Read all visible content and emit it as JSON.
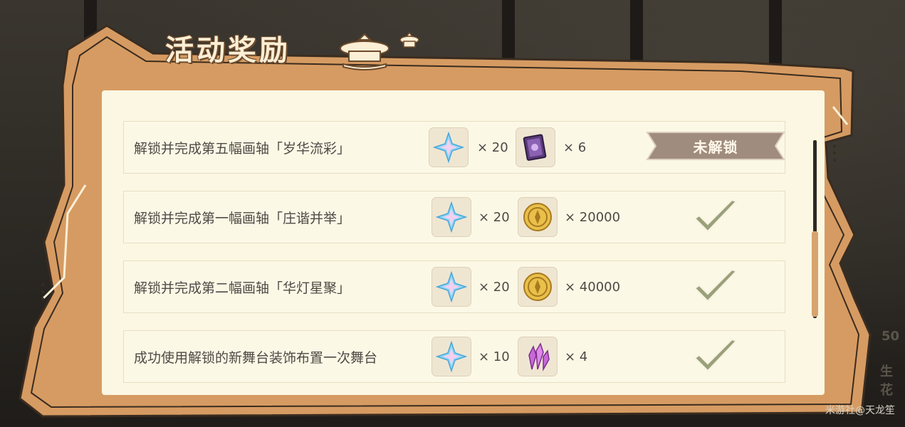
{
  "panel": {
    "title": "活动奖励",
    "rows": [
      {
        "label": "解锁并完成第五幅画轴「岁华流彩」",
        "rewards": [
          {
            "icon": "primogem-icon",
            "qty": "× 20"
          },
          {
            "icon": "book-icon",
            "qty": "× 6"
          }
        ],
        "status": "locked",
        "status_label": "未解锁"
      },
      {
        "label": "解锁并完成第一幅画轴「庄谐并举」",
        "rewards": [
          {
            "icon": "primogem-icon",
            "qty": "× 20"
          },
          {
            "icon": "mora-icon",
            "qty": "× 20000"
          }
        ],
        "status": "claimed"
      },
      {
        "label": "解锁并完成第二幅画轴「华灯星聚」",
        "rewards": [
          {
            "icon": "primogem-icon",
            "qty": "× 20"
          },
          {
            "icon": "mora-icon",
            "qty": "× 40000"
          }
        ],
        "status": "claimed"
      },
      {
        "label": "成功使用解锁的新舞台装饰布置一次舞台",
        "rewards": [
          {
            "icon": "primogem-icon",
            "qty": "× 10"
          },
          {
            "icon": "crystal-icon",
            "qty": "× 4"
          }
        ],
        "status": "claimed"
      }
    ]
  },
  "background_hints": {
    "number": "50",
    "text": "生花"
  },
  "watermark": "米游社@天龙笙",
  "colors": {
    "frame": "#d69b62",
    "panel": "#fbf7e2",
    "check": "#9aa07a",
    "locked": "#a08c7e"
  }
}
